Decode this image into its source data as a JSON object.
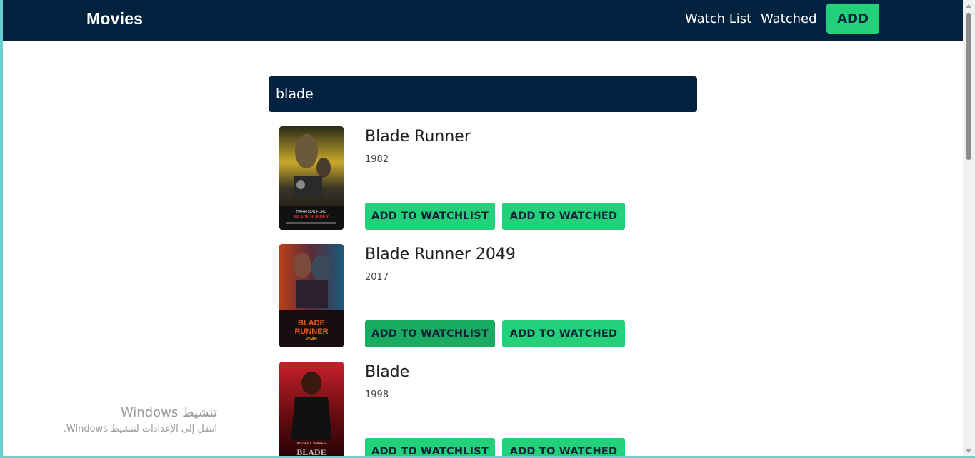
{
  "navbar": {
    "brand": "Movies",
    "links": [
      "Watch List",
      "Watched"
    ],
    "add_label": "ADD"
  },
  "search": {
    "value": "blade"
  },
  "results": [
    {
      "title": "Blade Runner",
      "year": "1982",
      "add_watchlist_label": "ADD TO WATCHLIST",
      "add_watched_label": "ADD TO WATCHED",
      "poster_text": [
        "HARRISON FORD",
        "BLADE RUNNER"
      ]
    },
    {
      "title": "Blade Runner 2049",
      "year": "2017",
      "add_watchlist_label": "ADD TO WATCHLIST",
      "add_watched_label": "ADD TO WATCHED",
      "poster_text": [
        "BLADE",
        "RUNNER",
        "2049"
      ]
    },
    {
      "title": "Blade",
      "year": "1998",
      "add_watchlist_label": "ADD TO WATCHLIST",
      "add_watched_label": "ADD TO WATCHED",
      "poster_text": [
        "WESLEY SNIPES",
        "BLADE"
      ]
    }
  ],
  "watermark": {
    "title": "تنشيط Windows",
    "subtitle": "انتقل إلى الإعدادات لتنشيط Windows."
  },
  "colors": {
    "navbar_bg": "#02223f",
    "accent": "#22d17a",
    "accent_hover": "#1aab62",
    "frame_border": "#6bcfcf"
  }
}
